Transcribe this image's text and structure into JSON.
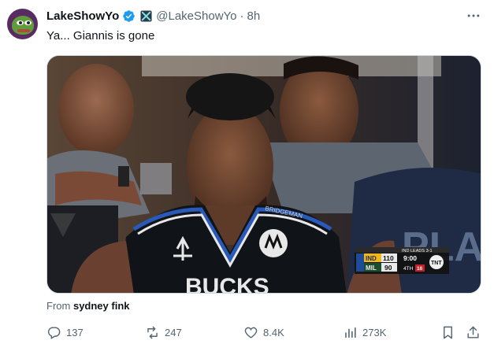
{
  "tweet": {
    "display_name": "LakeShowYo",
    "handle": "@LakeShowYo",
    "separator": "·",
    "time": "8h",
    "text": "Ya... Giannis is gone",
    "source_prefix": "From",
    "source_name": "sydney fink"
  },
  "media": {
    "description_icon": "video-thumbnail",
    "scorebug": {
      "team1": "IND",
      "score1": "110",
      "team2": "MIL",
      "score2": "90",
      "clock": "9:00",
      "quarter": "4TH",
      "shot_clock": "16",
      "network": "TNT",
      "banner": "IND LEADS 3-1"
    },
    "jersey_text": "BUCKS",
    "background_text": "PLAY"
  },
  "actions": {
    "replies": "137",
    "retweets": "247",
    "likes": "8.4K",
    "views": "273K"
  },
  "colors": {
    "verified": "#1d9bf0",
    "secondary_text": "#536471",
    "primary_text": "#0f1419"
  }
}
